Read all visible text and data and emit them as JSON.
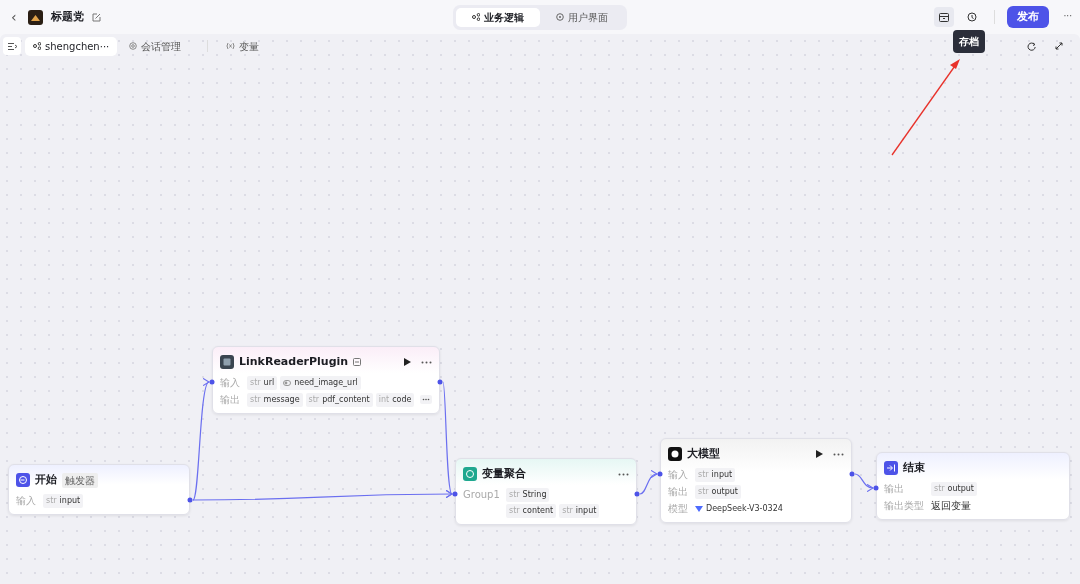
{
  "header": {
    "back": "‹",
    "title": "标题党",
    "view_tabs": [
      {
        "label": "业务逻辑",
        "selected": true
      },
      {
        "label": "用户界面",
        "selected": false
      }
    ],
    "tooltip": "存档",
    "publish": "发布",
    "more": "···"
  },
  "toolbar": {
    "tabs": [
      {
        "label": "shengchen···",
        "selected": true
      },
      {
        "label": "会话管理",
        "selected": false
      },
      {
        "label": "变量",
        "selected": false
      }
    ]
  },
  "nodes": [
    {
      "kind": "start",
      "title": "开始",
      "badge": "触发器",
      "menu": false,
      "run": false,
      "rows": [
        {
          "label": "输入",
          "chips": [
            {
              "type": "str",
              "name": "input"
            }
          ]
        }
      ]
    },
    {
      "kind": "plugin",
      "title": "LinkReaderPlugin",
      "menu": true,
      "run": true,
      "rows": [
        {
          "label": "输入",
          "chips": [
            {
              "type": "str",
              "name": "url"
            },
            {
              "kind": "bool",
              "name": "need_image_url"
            }
          ]
        },
        {
          "label": "输出",
          "chips": [
            {
              "type": "str",
              "name": "message"
            },
            {
              "type": "str",
              "name": "pdf_content"
            },
            {
              "type": "int",
              "name": "code"
            }
          ]
        }
      ]
    },
    {
      "kind": "aggregate",
      "title": "变量聚合",
      "menu": true,
      "run": false,
      "rows": [
        {
          "label": "Group1",
          "chips": [
            {
              "type": "str",
              "name": "String"
            }
          ]
        },
        {
          "chips": [
            {
              "type": "str",
              "name": "content"
            },
            {
              "type": "str",
              "name": "input"
            }
          ]
        }
      ]
    },
    {
      "kind": "llm",
      "title": "大模型",
      "menu": true,
      "run": true,
      "rows": [
        {
          "label": "输入",
          "chips": [
            {
              "type": "str",
              "name": "input"
            }
          ]
        },
        {
          "label": "输出",
          "chips": [
            {
              "type": "str",
              "name": "output"
            }
          ]
        },
        {
          "label": "模型",
          "chips": [
            {
              "kind": "model",
              "name": "DeepSeek-V3-0324"
            }
          ]
        }
      ]
    },
    {
      "kind": "end",
      "title": "结束",
      "menu": false,
      "run": false,
      "rows": [
        {
          "label": "输出",
          "chips": [
            {
              "type": "str",
              "name": "output"
            }
          ]
        },
        {
          "label": "输出类型",
          "chips": [
            {
              "kind": "plain",
              "name": "返回变量"
            }
          ]
        }
      ]
    }
  ]
}
